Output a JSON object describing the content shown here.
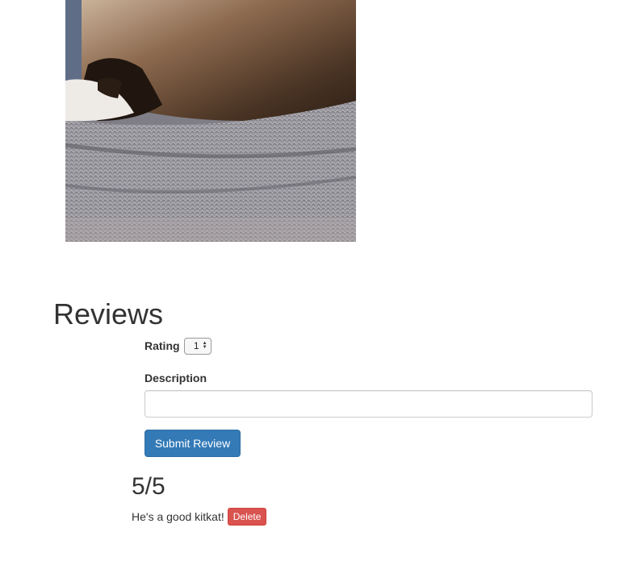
{
  "photo": {
    "alt": "cat on knit blanket"
  },
  "reviews": {
    "title": "Reviews",
    "form": {
      "rating_label": "Rating",
      "rating_value": "1",
      "description_label": "Description",
      "description_value": "",
      "submit_label": "Submit Review"
    },
    "items": [
      {
        "score": "5/5",
        "text": "He's a good kitkat!",
        "delete_label": "Delete"
      }
    ]
  }
}
